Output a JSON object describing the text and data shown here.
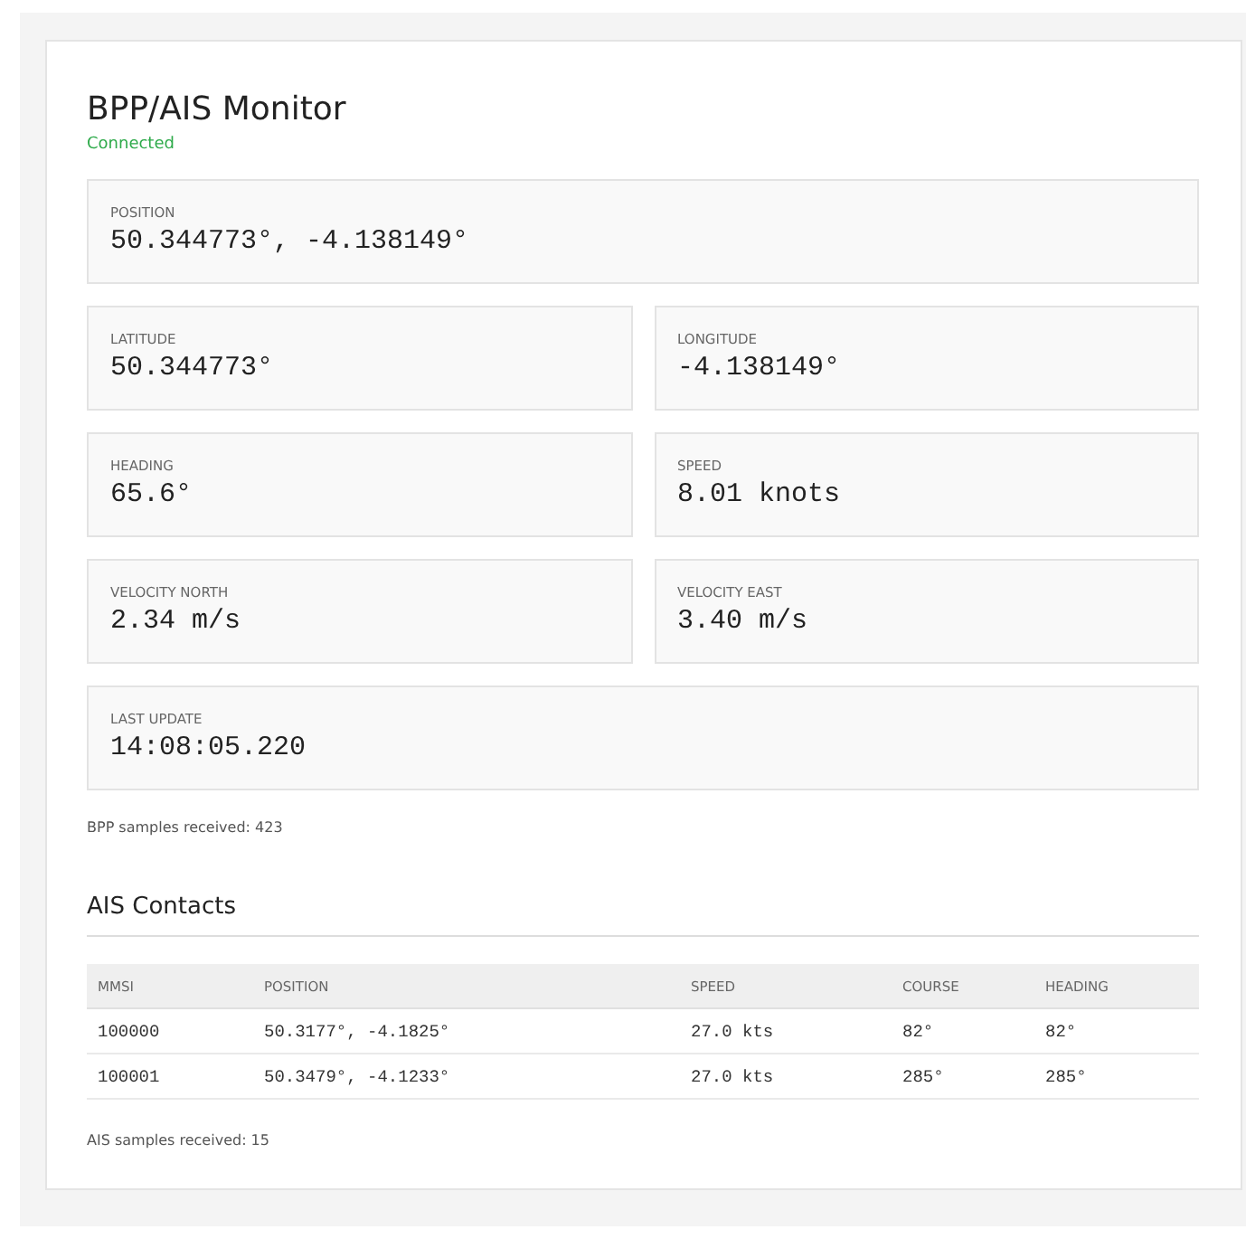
{
  "title": "BPP/AIS Monitor",
  "status": {
    "text": "Connected",
    "connected": true
  },
  "field_rows": [
    [
      {
        "label": "POSITION",
        "value": "50.344773°, -4.138149°"
      }
    ],
    [
      {
        "label": "LATITUDE",
        "value": "50.344773°"
      },
      {
        "label": "LONGITUDE",
        "value": "-4.138149°"
      }
    ],
    [
      {
        "label": "HEADING",
        "value": "65.6°"
      },
      {
        "label": "SPEED",
        "value": "8.01 knots"
      }
    ],
    [
      {
        "label": "VELOCITY NORTH",
        "value": "2.34 m/s"
      },
      {
        "label": "VELOCITY EAST",
        "value": "3.40 m/s"
      }
    ],
    [
      {
        "label": "LAST UPDATE",
        "value": "14:08:05.220"
      }
    ]
  ],
  "bpp_samples": "BPP samples received: 423",
  "ais": {
    "title": "AIS Contacts",
    "table": {
      "columns": [
        "MMSI",
        "POSITION",
        "SPEED",
        "COURSE",
        "HEADING"
      ],
      "rows": [
        [
          "100000",
          "50.3177°, -4.1825°",
          "27.0 kts",
          "82°",
          "82°"
        ],
        [
          "100001",
          "50.3479°, -4.1233°",
          "27.0 kts",
          "285°",
          "285°"
        ]
      ]
    },
    "samples": "AIS samples received: 15"
  }
}
